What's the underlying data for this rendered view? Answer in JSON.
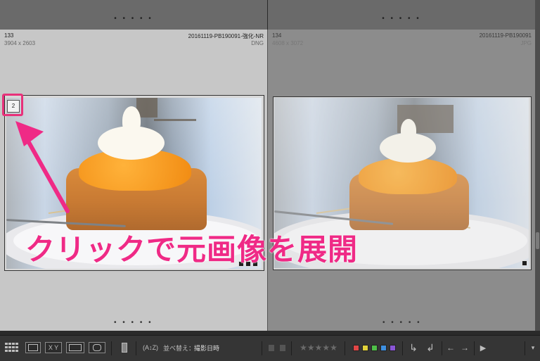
{
  "cells": [
    {
      "index": "133",
      "filename": "20161119-PB190091-強化-NR",
      "dimensions": "3904 x 2603",
      "format": "DNG",
      "stack_badge": "2"
    },
    {
      "index": "134",
      "filename": "20161119-PB190091",
      "dimensions": "4608 x 3072",
      "format": "JPG"
    }
  ],
  "overlay_caption": "クリックで元画像を展開",
  "toolbar": {
    "sort_label": "並べ替え：",
    "sort_value": "撮影日時",
    "view_grid_icon": "grid-view-icon",
    "view_loupe_icon": "loupe-view-icon",
    "view_compare_label": "X Y",
    "view_survey_icon": "survey-view-icon",
    "view_people_icon": "people-view-icon",
    "color_labels": [
      "#e04646",
      "#e0d13a",
      "#4fbf48",
      "#3e8fe0",
      "#8a55d6"
    ]
  },
  "dots": "• • • • •"
}
